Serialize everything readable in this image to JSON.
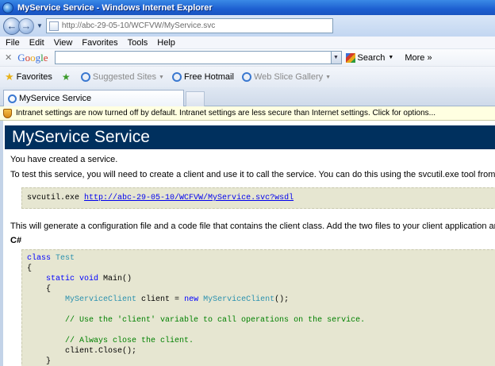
{
  "window": {
    "title": "MyService Service - Windows Internet Explorer"
  },
  "address": {
    "url": "http://abc-29-05-10/WCFVW/MyService.svc"
  },
  "menu": [
    "File",
    "Edit",
    "View",
    "Favorites",
    "Tools",
    "Help"
  ],
  "google_toolbar": {
    "logo_parts": [
      "G",
      "o",
      "o",
      "g",
      "l",
      "e"
    ],
    "search_label": "Search",
    "more_label": "More"
  },
  "favorites_bar": {
    "favorites_label": "Favorites",
    "items": [
      {
        "label": "Suggested Sites",
        "dim": true
      },
      {
        "label": "Free Hotmail",
        "dim": false
      },
      {
        "label": "Web Slice Gallery",
        "dim": true
      }
    ]
  },
  "tab": {
    "label": "MyService Service"
  },
  "infobar": {
    "text": "Intranet settings are now turned off by default. Intranet settings are less secure than Internet settings. Click for options..."
  },
  "page": {
    "banner_title": "MyService Service",
    "created_text": "You have created a service.",
    "test_text": "To test this service, you will need to create a client and use it to call the service. You can do this using the svcutil.exe tool from the command line",
    "svcutil_cmd": "svcutil.exe",
    "svcutil_link": "http://abc-29-05-10/WCFVW/MyService.svc?wsdl",
    "generate_text": "This will generate a configuration file and a code file that contains the client class. Add the two files to your client application and use the generated",
    "cs_heading": "C#",
    "code": {
      "l1_kw": "class",
      "l1_ty": "Test",
      "l2": "{",
      "l3_kw": "static void",
      "l3_rest": "Main()",
      "l4": "{",
      "l5_ty1": "MyServiceClient",
      "l5_mid": "client =",
      "l5_kw": "new",
      "l5_ty2": "MyServiceClient",
      "l5_end": "();",
      "l6_cm": "// Use the 'client' variable to call operations on the service.",
      "l7_cm": "// Always close the client.",
      "l8": "client.Close();",
      "l9": "}",
      "l10": "}"
    }
  }
}
